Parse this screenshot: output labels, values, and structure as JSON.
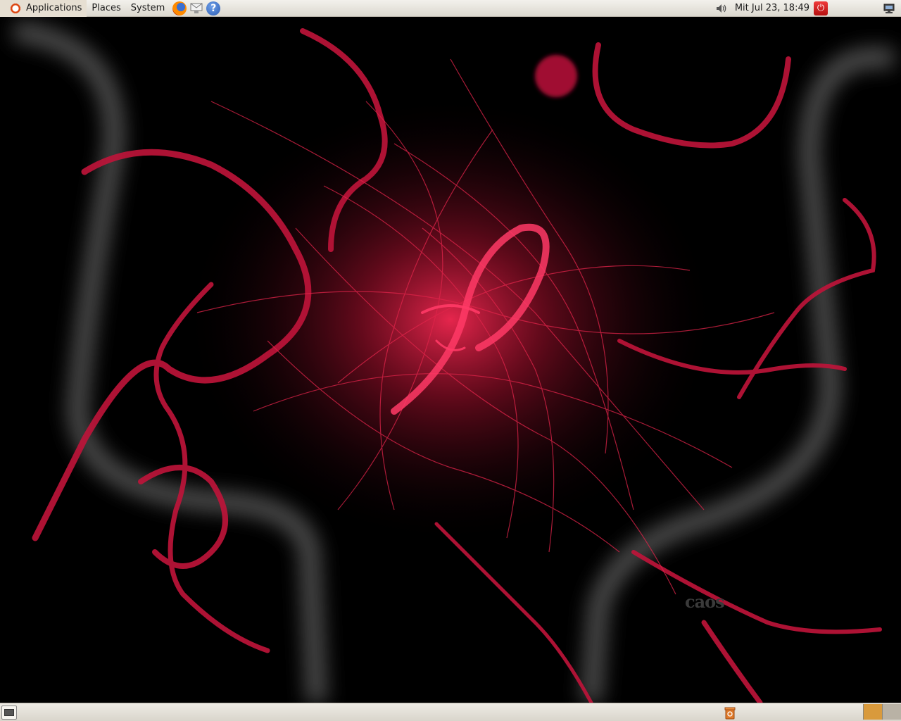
{
  "top_panel": {
    "menus": {
      "applications": "Applications",
      "places": "Places",
      "system": "System"
    },
    "launchers": [
      "firefox-icon",
      "mail-icon",
      "help-icon"
    ],
    "help_glyph": "?",
    "clock": "Mit Jul 23, 18:49"
  },
  "desktop": {
    "watermark": "caos"
  },
  "bottom_panel": {
    "workspaces": [
      {
        "name": "workspace-1",
        "active": true
      },
      {
        "name": "workspace-2",
        "active": false
      }
    ]
  },
  "colors": {
    "panel": "#dcd8cf",
    "wallpaper_red": "#c0143a",
    "wallpaper_glow": "#ff2a55",
    "workspace_active": "#d99a3c"
  }
}
